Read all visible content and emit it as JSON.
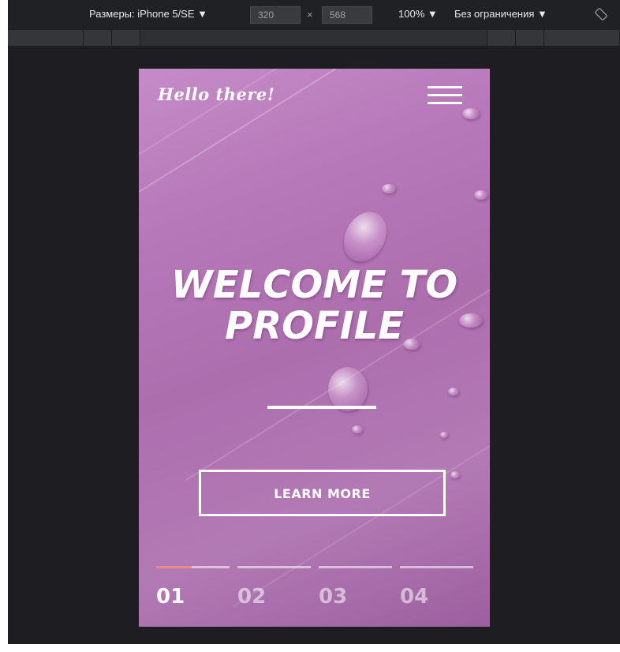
{
  "toolbar": {
    "device_label": "Размеры: iPhone 5/SE ▼",
    "width_value": "320",
    "times_sign": "×",
    "height_value": "568",
    "zoom_label": "100% ▼",
    "throttle_label": "Без ограничения ▼",
    "rotate_icon": "rotate-icon"
  },
  "page": {
    "logo_text": "Hello there!",
    "menu_icon": "hamburger-menu-icon",
    "hero_line1": "WELCOME TO",
    "hero_line2": "PROFILE",
    "cta_label": "LEARN MORE",
    "slides": [
      {
        "number": "01",
        "active": true,
        "progress": 0.48
      },
      {
        "number": "02",
        "active": false,
        "progress": 0
      },
      {
        "number": "03",
        "active": false,
        "progress": 0
      },
      {
        "number": "04",
        "active": false,
        "progress": 0
      }
    ]
  },
  "colors": {
    "devtools_bg": "#1e1e22",
    "hero_accent": "#b678b8",
    "progress_accent": "#e98a8a"
  }
}
